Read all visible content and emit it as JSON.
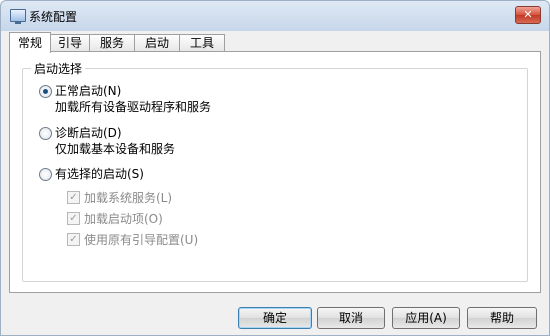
{
  "window": {
    "title": "系统配置",
    "close_glyph": "✕"
  },
  "tabs": [
    {
      "label": "常规",
      "active": true
    },
    {
      "label": "引导",
      "active": false
    },
    {
      "label": "服务",
      "active": false
    },
    {
      "label": "启动",
      "active": false
    },
    {
      "label": "工具",
      "active": false
    }
  ],
  "startup_selection": {
    "legend": "启动选择",
    "normal": {
      "label": "正常启动(N)",
      "description": "加载所有设备驱动程序和服务",
      "selected": true
    },
    "diagnostic": {
      "label": "诊断启动(D)",
      "description": "仅加载基本设备和服务",
      "selected": false
    },
    "selective": {
      "label": "有选择的启动(S)",
      "selected": false,
      "options": [
        {
          "label": "加载系统服务(L)",
          "checked": true,
          "enabled": false
        },
        {
          "label": "加载启动项(O)",
          "checked": true,
          "enabled": false
        },
        {
          "label": "使用原有引导配置(U)",
          "checked": true,
          "enabled": false
        }
      ]
    }
  },
  "buttons": {
    "ok": "确定",
    "cancel": "取消",
    "apply": "应用(A)",
    "help": "帮助"
  }
}
